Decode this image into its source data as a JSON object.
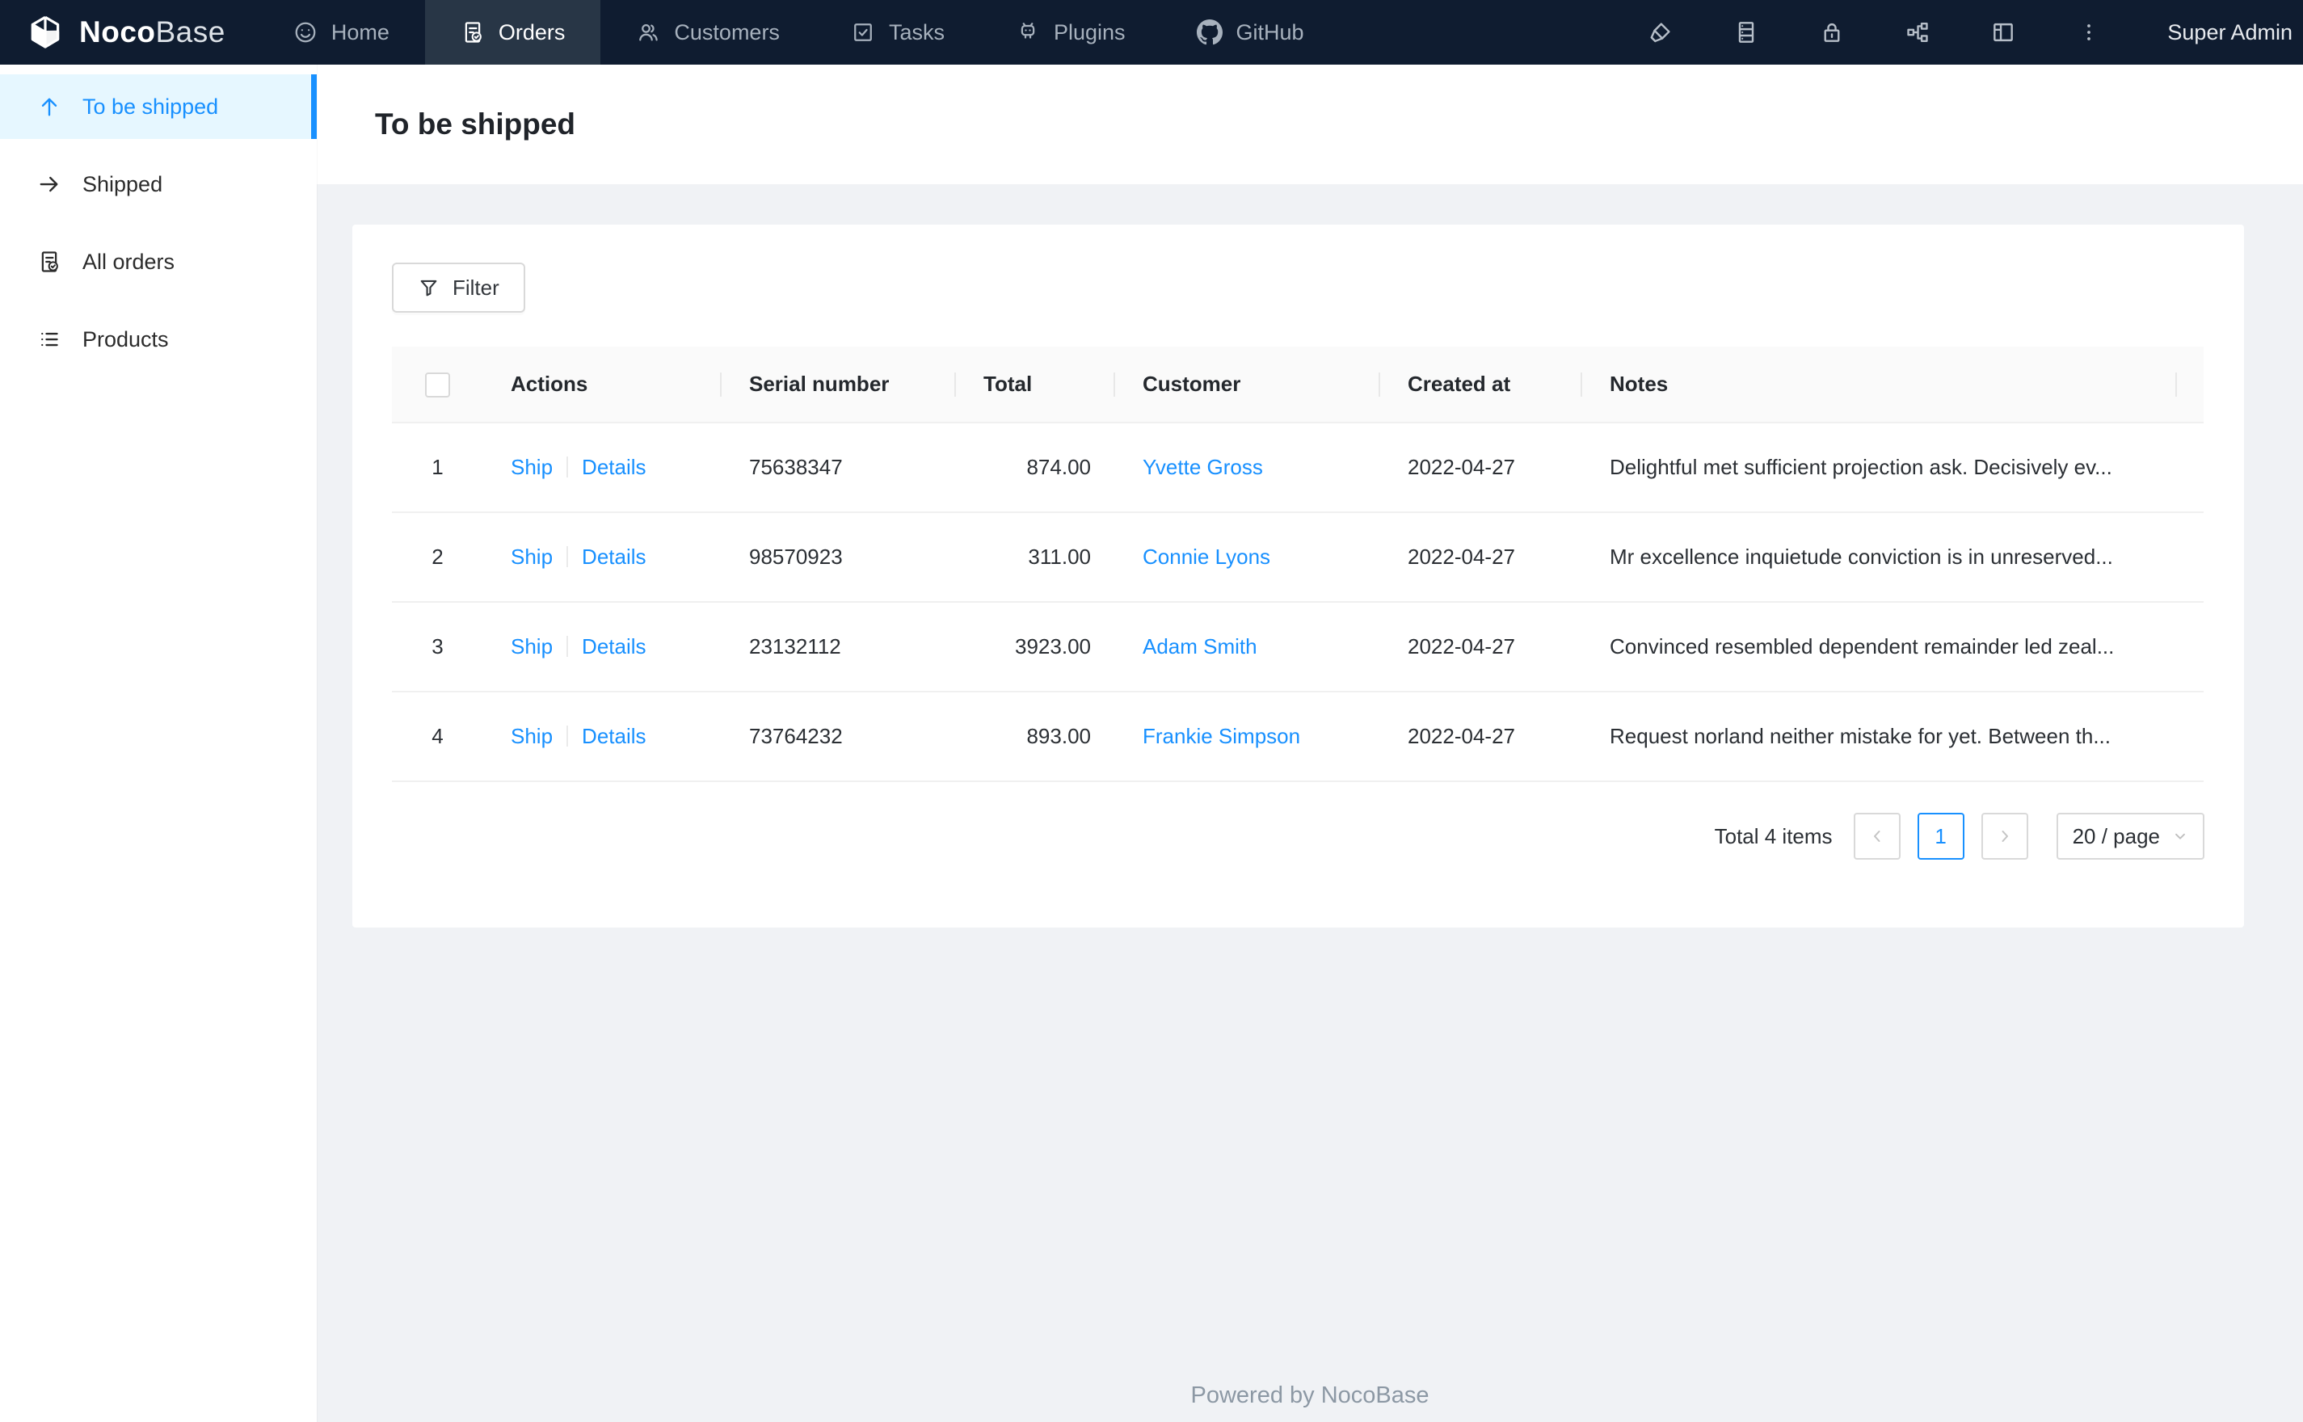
{
  "navbar": {
    "brand": {
      "bold": "Noco",
      "light": "Base"
    },
    "items": [
      {
        "label": "Home",
        "icon": "smiley-icon",
        "active": false
      },
      {
        "label": "Orders",
        "icon": "file-done-icon",
        "active": true
      },
      {
        "label": "Customers",
        "icon": "team-icon",
        "active": false
      },
      {
        "label": "Tasks",
        "icon": "check-square-icon",
        "active": false
      },
      {
        "label": "Plugins",
        "icon": "robot-icon",
        "active": false
      },
      {
        "label": "GitHub",
        "icon": "github-icon",
        "active": false
      }
    ],
    "tools": [
      "highlighter-icon",
      "database-icon",
      "lock-icon",
      "partition-icon",
      "layout-icon",
      "more-vertical-icon"
    ],
    "user": "Super Admin"
  },
  "sidebar": {
    "items": [
      {
        "label": "To be shipped",
        "icon": "arrow-up-icon",
        "active": true
      },
      {
        "label": "Shipped",
        "icon": "arrow-right-icon",
        "active": false
      },
      {
        "label": "All orders",
        "icon": "file-done-icon",
        "active": false
      },
      {
        "label": "Products",
        "icon": "unordered-list-icon",
        "active": false
      }
    ]
  },
  "page": {
    "title": "To be shipped"
  },
  "toolbar": {
    "filter_label": "Filter",
    "filter_icon": "funnel-icon"
  },
  "table": {
    "columns": [
      "Actions",
      "Serial number",
      "Total",
      "Customer",
      "Created at",
      "Notes"
    ],
    "rows": [
      {
        "index": "1",
        "ship": "Ship",
        "details": "Details",
        "serial": "75638347",
        "total": "874.00",
        "customer": "Yvette Gross",
        "created": "2022-04-27",
        "notes": "Delightful met sufficient projection ask. Decisively ev..."
      },
      {
        "index": "2",
        "ship": "Ship",
        "details": "Details",
        "serial": "98570923",
        "total": "311.00",
        "customer": "Connie Lyons",
        "created": "2022-04-27",
        "notes": "Mr excellence inquietude conviction is in unreserved..."
      },
      {
        "index": "3",
        "ship": "Ship",
        "details": "Details",
        "serial": "23132112",
        "total": "3923.00",
        "customer": "Adam Smith",
        "created": "2022-04-27",
        "notes": "Convinced resembled dependent remainder led zeal..."
      },
      {
        "index": "4",
        "ship": "Ship",
        "details": "Details",
        "serial": "73764232",
        "total": "893.00",
        "customer": "Frankie Simpson",
        "created": "2022-04-27",
        "notes": "Request norland neither mistake for yet. Between th..."
      }
    ]
  },
  "pagination": {
    "total_text": "Total 4 items",
    "current_page": "1",
    "page_size_label": "20 / page"
  },
  "footer": {
    "text": "Powered by NocoBase"
  },
  "colors": {
    "accent": "#1890ff",
    "navbar_bg": "#0f1c30",
    "navbar_active_bg": "#283646",
    "sidebar_active_bg": "#e6f7ff",
    "content_bg": "#f0f2f5",
    "table_header_bg": "#fafafa",
    "border": "#f0f0f0"
  }
}
